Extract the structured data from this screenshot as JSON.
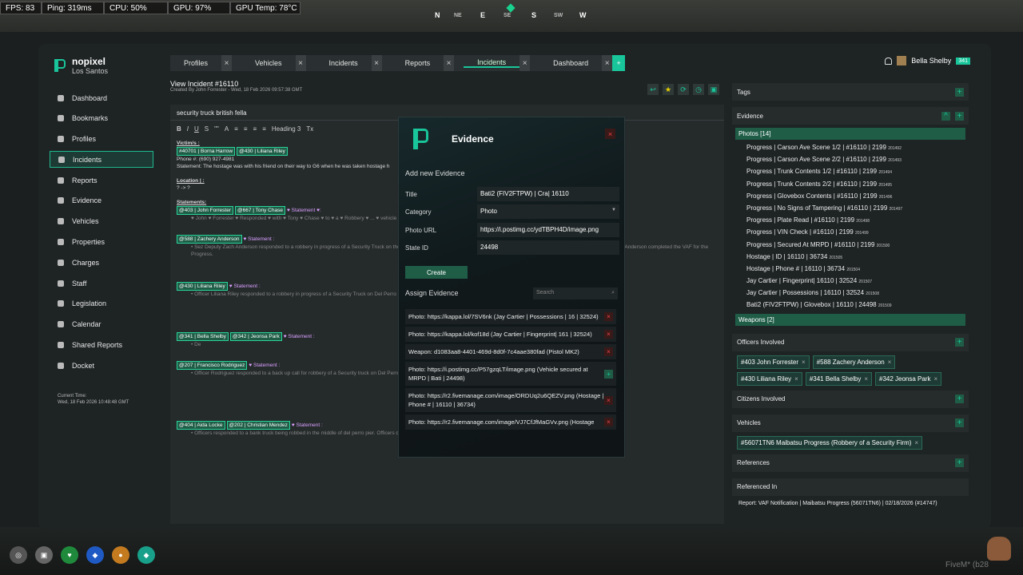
{
  "hud": [
    "FPS: 83",
    "Ping: 319ms",
    "CPU: 50%",
    "GPU: 97%",
    "GPU Temp: 78°C"
  ],
  "compass": {
    "n": "N",
    "ne": "NE",
    "e": "E",
    "se": "SE",
    "s": "S",
    "sw": "SW",
    "w": "W"
  },
  "brand": {
    "name": "nopixel",
    "city": "Los Santos"
  },
  "sidebar": {
    "items": [
      "Dashboard",
      "Bookmarks",
      "Profiles",
      "Incidents",
      "Reports",
      "Evidence",
      "Vehicles",
      "Properties",
      "Charges",
      "Staff",
      "Legislation",
      "Calendar",
      "Shared Reports",
      "Docket"
    ],
    "current_time_label": "Current Time:",
    "current_time": "Wed, 18 Feb 2026 10:48:48 GMT"
  },
  "tabs": [
    "Profiles",
    "Vehicles",
    "Incidents",
    "Reports",
    "Incidents",
    "Dashboard"
  ],
  "user": {
    "name": "Bella Shelby",
    "badge": "341"
  },
  "incident": {
    "view_title": "View Incident #16110",
    "created": "Created By John Forrester - Wed, 18 Feb 2026 09:57:38 GMT",
    "title": "security truck british fella"
  },
  "editor": {
    "toolbar": [
      "B",
      "I",
      "U",
      "S",
      "\"\"",
      "A",
      "≡",
      "≡",
      "≡",
      "≡",
      "Heading 3",
      "Tx"
    ],
    "victims_label": "Victim/s :",
    "victim1": "#40701 | Borna Harrow",
    "victim2": "@430 | Liliana Riley",
    "phone": "Phone #: (690) 927-4981",
    "statement1": "Statement: The hostage was with his friend on their way to G6 when he was taken hostage h",
    "location_label": "Location | :",
    "location_val": "? -> ?",
    "statements_label": "Statements:",
    "s1a": "@403 | John Forrester",
    "s1b": "@667 | Tony Chase",
    "s1stmt": "♥ Statement ♥:",
    "s1text": "♥ John ♥ Forrester ♥ Responded ♥ with ♥ Tony ♥ Chase ♥ to ♥ a ♥ Robbery ♥ ... ♥ vehicle ♥ until ♥ they ♥ crashed ♥",
    "s2a": "@588 | Zachery Anderson",
    "s2stmt": "♥ Statement :",
    "s2text": "• Sez Deputy Zach Anderson responded to a robbery in progress of a Security Truck on the Del Perro Pier ... crashed in a parking lot ... Cash & a Gruppe6 Security Card in the Glovebox. Z. Anderson completed the VAF for the Progress.",
    "s3a": "@430 | Liliana Riley",
    "s3stmt": "♥ Statement :",
    "s3text": "• Officer Liliana Riley responded to a robbery in progress of a Security Truck on Del Perro Pier ... Officer Riley then stayed mobile while Offi",
    "s4a": "@341 | Bella Shelby",
    "s4b": "@342 | Jeonsa Park",
    "s4stmt": "♥ Statement :",
    "s4text": "• De",
    "s5a": "@207 | Francisco Rodriguez",
    "s5stmt": "♥ Statement :",
    "s5text": "• Officer Rodriguez responded to a back up call for robbery of a Security truck on Del Perro pier ... guilty to all charges.",
    "s6a": "@404 | Aida Locke",
    "s6b": "@202 | Christian Mendez",
    "s6stmt": "♥ Statement :",
    "s6text": "• Officers responded to a bank truck being robbed in the middle of del perro pier. Officers chased after the suspects ... plead guilty to his charges before being sent off."
  },
  "modal": {
    "title": "Evidence",
    "add_label": "Add new Evidence",
    "fields": [
      {
        "label": "Title",
        "value": "Bati2 (FIV2FTPW) | Cra| 16110"
      },
      {
        "label": "Category",
        "value": "Photo"
      },
      {
        "label": "Photo URL",
        "value": "https://i.postimg.cc/ydTBPH4D/image.png"
      },
      {
        "label": "State ID",
        "value": "24498"
      }
    ],
    "create": "Create",
    "assign": "Assign Evidence",
    "search_placeholder": "Search",
    "list": [
      {
        "text": "Photo: https://kappa.lol/7SV6nk (Jay Cartier | Possessions | 16 | 32524)",
        "action": "remove"
      },
      {
        "text": "Photo: https://kappa.lol/kof18d (Jay Cartier | Fingerprint| 161 | 32524)",
        "action": "remove"
      },
      {
        "text": "Weapon: d1083aa8-4401-469d-8d0f-7c4aae380fad (Pistol MK2)",
        "action": "remove"
      },
      {
        "text": "Photo: https://i.postimg.cc/P57gzqLT/image.png (Vehicle secured at MRPD | Bati | 24498)",
        "action": "add"
      },
      {
        "text": "Photo: https://r2.fivemanage.com/image/ORDUq2u6QEZV.png (Hostage | Phone # | 16110 | 36734)",
        "action": "remove"
      },
      {
        "text": "Photo: https://r2.fivemanage.com/image/VJ7CfJfMaGVv.png (Hostage",
        "action": "remove"
      }
    ]
  },
  "right": {
    "tags": "Tags",
    "evidence": "Evidence",
    "photos": "Photos [14]",
    "photo_items": [
      {
        "t": "Progress | Carson Ave Scene 1/2 | #16110 | 2199",
        "n": "201492"
      },
      {
        "t": "Progress | Carson Ave Scene 2/2 | #16110 | 2199",
        "n": "201493"
      },
      {
        "t": "Progress | Trunk Contents 1/2 | #16110 | 2199",
        "n": "201494"
      },
      {
        "t": "Progress | Trunk Contents 2/2 | #16110 | 2199",
        "n": "201495"
      },
      {
        "t": "Progress | Glovebox Contents | #16110 | 2199",
        "n": "201496"
      },
      {
        "t": "Progress | No Signs of Tampering | #16110 | 2199",
        "n": "201497"
      },
      {
        "t": "Progress | Plate Read | #16110 | 2199",
        "n": "201498"
      },
      {
        "t": "Progress | VIN Check | #16110 | 2199",
        "n": "201499"
      },
      {
        "t": "Progress | Secured At MRPD | #16110 | 2199",
        "n": "201500"
      },
      {
        "t": "Hostage | ID | 16110 | 36734",
        "n": "201505"
      },
      {
        "t": "Hostage | Phone # | 16110 | 36734",
        "n": "201504"
      },
      {
        "t": "Jay Cartier | Fingerprint| 16110 | 32524",
        "n": "201507"
      },
      {
        "t": "Jay Cartier | Possessions | 16110 | 32524",
        "n": "201508"
      },
      {
        "t": "Bati2 (FIV2FTPW) | Glovebox | 16110 | 24498",
        "n": "201509"
      }
    ],
    "weapons": "Weapons [2]",
    "officers_label": "Officers Involved",
    "officers": [
      "#403 John Forrester",
      "#588 Zachery Anderson",
      "#430 Liliana Riley",
      "#341 Bella Shelby",
      "#342 Jeonsa Park"
    ],
    "citizens_label": "Citizens Involved",
    "vehicles_label": "Vehicles",
    "vehicles": [
      "#56071TN6 Maibatsu Progress (Robbery of a Security Firm)"
    ],
    "references_label": "References",
    "referenced_label": "Referenced In",
    "referenced_item": "Report: VAF Notification | Maibatsu Progress (56071TN6) | 02/18/2026 (#14747)"
  },
  "footer": {
    "fivem": "FiveM* (b28"
  }
}
